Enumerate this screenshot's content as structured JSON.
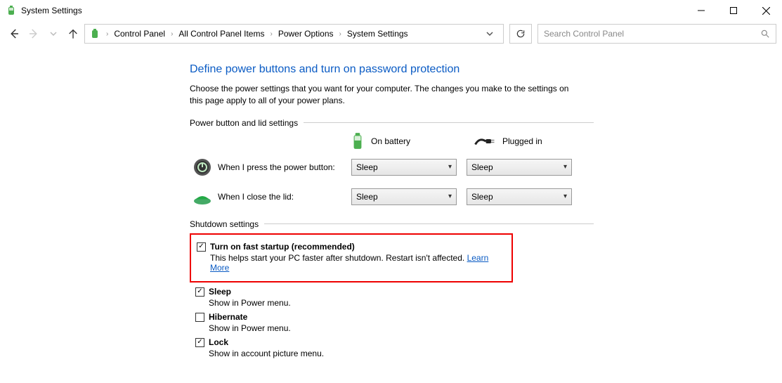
{
  "window": {
    "title": "System Settings"
  },
  "breadcrumb": {
    "items": [
      "Control Panel",
      "All Control Panel Items",
      "Power Options",
      "System Settings"
    ]
  },
  "search": {
    "placeholder": "Search Control Panel"
  },
  "page": {
    "heading": "Define power buttons and turn on password protection",
    "description": "Choose the power settings that you want for your computer. The changes you make to the settings on this page apply to all of your power plans."
  },
  "sections": {
    "power_button": {
      "title": "Power button and lid settings",
      "col_battery": "On battery",
      "col_plugged": "Plugged in",
      "rows": [
        {
          "label": "When I press the power button:",
          "battery": "Sleep",
          "plugged": "Sleep"
        },
        {
          "label": "When I close the lid:",
          "battery": "Sleep",
          "plugged": "Sleep"
        }
      ]
    },
    "shutdown": {
      "title": "Shutdown settings",
      "items": [
        {
          "label": "Turn on fast startup (recommended)",
          "checked": true,
          "sub": "This helps start your PC faster after shutdown. Restart isn't affected.",
          "link": "Learn More"
        },
        {
          "label": "Sleep",
          "checked": true,
          "sub": "Show in Power menu."
        },
        {
          "label": "Hibernate",
          "checked": false,
          "sub": "Show in Power menu."
        },
        {
          "label": "Lock",
          "checked": true,
          "sub": "Show in account picture menu."
        }
      ]
    }
  }
}
